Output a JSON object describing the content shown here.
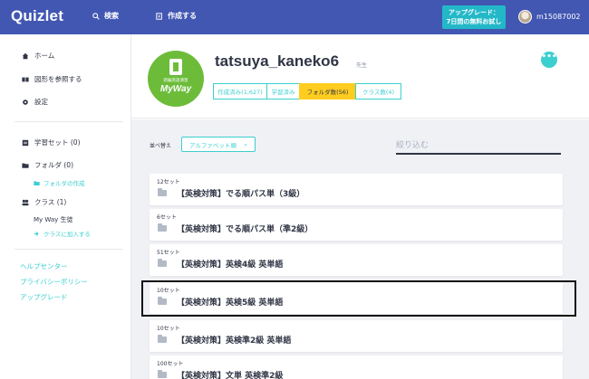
{
  "topbar": {
    "logo": "Quizlet",
    "search_label": "検索",
    "create_label": "作成する",
    "upgrade_line1": "アップグレード：",
    "upgrade_line2": "7日間の無料お試し",
    "username": "m15087002"
  },
  "sidebar": {
    "home": "ホーム",
    "browse": "図形を参照する",
    "settings": "設定",
    "study_sets": "学習セット (0)",
    "folders": "フォルダ (0)",
    "create_folder": "フォルダの作成",
    "classes": "クラス (1)",
    "class_name": "My Way 生徒",
    "join_class": "クラスに加入する",
    "help": "ヘルプセンター",
    "privacy": "プライバシーポリシー",
    "upgrade": "アップグレード"
  },
  "profile": {
    "avatar_small_text": "新編英語演習",
    "avatar_brand": "MyWay",
    "username": "tatsuya_kaneko6",
    "role": "先生",
    "tabs": [
      {
        "label": "作成済み(1,627)",
        "active": false
      },
      {
        "label": "学習済み",
        "active": false
      },
      {
        "label": "フォルダ数(56)",
        "active": true
      },
      {
        "label": "クラス数(4)",
        "active": false
      }
    ],
    "more_label": "•••"
  },
  "main": {
    "sort_label": "並べ替え",
    "sort_value": "アルファベット順",
    "filter_placeholder": "絞り込む",
    "folders": [
      {
        "count": "12セット",
        "title": "【英検対策】でる順パス単（3級）"
      },
      {
        "count": "6セット",
        "title": "【英検対策】でる順パス単（準2級）"
      },
      {
        "count": "51セット",
        "title": "【英検対策】英検4級 英単語"
      },
      {
        "count": "10セット",
        "title": "【英検対策】英検5級 英単語"
      },
      {
        "count": "10セット",
        "title": "【英検対策】英検準2級 英単語"
      },
      {
        "count": "100セット",
        "title": "【英検対策】文単 英検準2級"
      }
    ]
  },
  "colors": {
    "topbar": "#4257b2",
    "accent": "#3ccfcf",
    "active_tab": "#ffcd1f",
    "avatar_bg": "#6cbc3a",
    "background": "#f0f1f5"
  }
}
